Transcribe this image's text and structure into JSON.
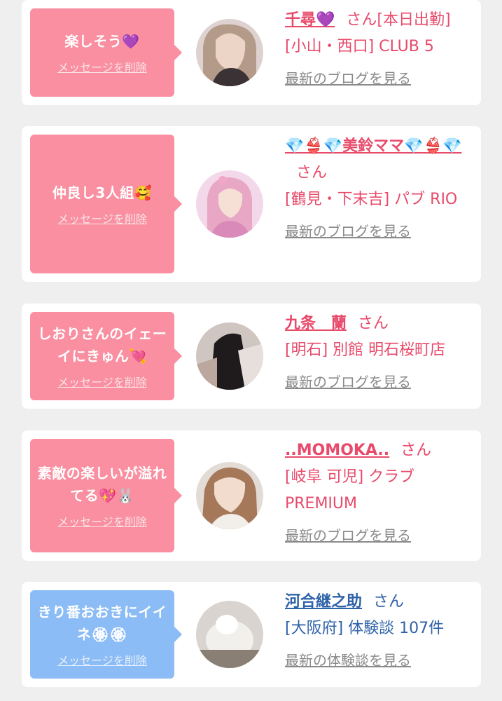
{
  "items": [
    {
      "message": "楽しそう💜",
      "delete_label": "メッセージを削除",
      "name": "千尋💜",
      "honorific": "さん[本日出勤]",
      "shop": "[小山・西口] CLUB 5",
      "link": "最新のブログを見る"
    },
    {
      "message": "仲良し3人組🥰",
      "delete_label": "メッセージを削除",
      "name": "💎👙💎美鈴ママ💎👙💎",
      "honorific": "さん",
      "shop": "[鶴見・下末吉] パブ RIO",
      "link": "最新のブログを見る"
    },
    {
      "message": "しおりさんのイェーイにきゅん💘",
      "delete_label": "メッセージを削除",
      "name": "九条　蘭",
      "honorific": "さん",
      "shop": "[明石] 別館 明石桜町店",
      "link": "最新のブログを見る"
    },
    {
      "message": "素敵の楽しいが溢れてる💖🐰",
      "delete_label": "メッセージを削除",
      "name": "..MOMOKA..",
      "honorific": "さん",
      "shop": "[岐阜 可児] クラブ PREMIUM",
      "link": "最新のブログを見る"
    },
    {
      "message": "きり番おおきにイイネ🏵🏵",
      "delete_label": "メッセージを削除",
      "name": "河合継之助",
      "honorific": "さん",
      "shop": "[大阪府] 体験談 107件",
      "link": "最新の体験談を見る"
    }
  ],
  "colors": {
    "background": "#efefef",
    "card": "#ffffff",
    "pink_bubble": "#f98fa0",
    "blue_bubble": "#8cbcf5",
    "pink_text": "#e84a6a",
    "blue_text": "#2f62a8",
    "link_gray": "#8a8a8a"
  }
}
